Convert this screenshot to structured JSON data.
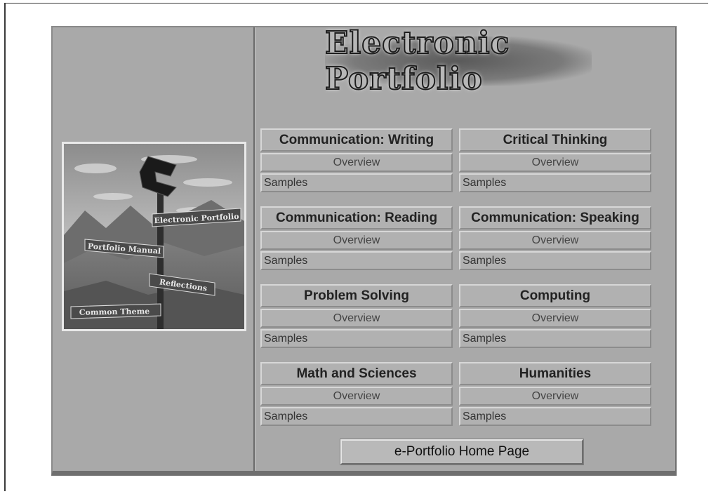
{
  "title": "Electronic Portfolio",
  "sign_labels": {
    "electronic_portfolio": "Electronic Portfolio",
    "portfolio_manual": "Portfolio Manual",
    "reflections": "Reflections",
    "common_theme": "Common Theme"
  },
  "topics": [
    {
      "label": "Communication: Writing",
      "overview": "Overview",
      "samples": "Samples"
    },
    {
      "label": "Critical Thinking",
      "overview": "Overview",
      "samples": "Samples"
    },
    {
      "label": "Communication: Reading",
      "overview": "Overview",
      "samples": "Samples"
    },
    {
      "label": "Communication: Speaking",
      "overview": "Overview",
      "samples": "Samples"
    },
    {
      "label": "Problem Solving",
      "overview": "Overview",
      "samples": "Samples"
    },
    {
      "label": "Computing",
      "overview": "Overview",
      "samples": "Samples"
    },
    {
      "label": "Math and Sciences",
      "overview": "Overview",
      "samples": "Samples"
    },
    {
      "label": "Humanities",
      "overview": "Overview",
      "samples": "Samples"
    }
  ],
  "home_button": "e-Portfolio Home Page"
}
